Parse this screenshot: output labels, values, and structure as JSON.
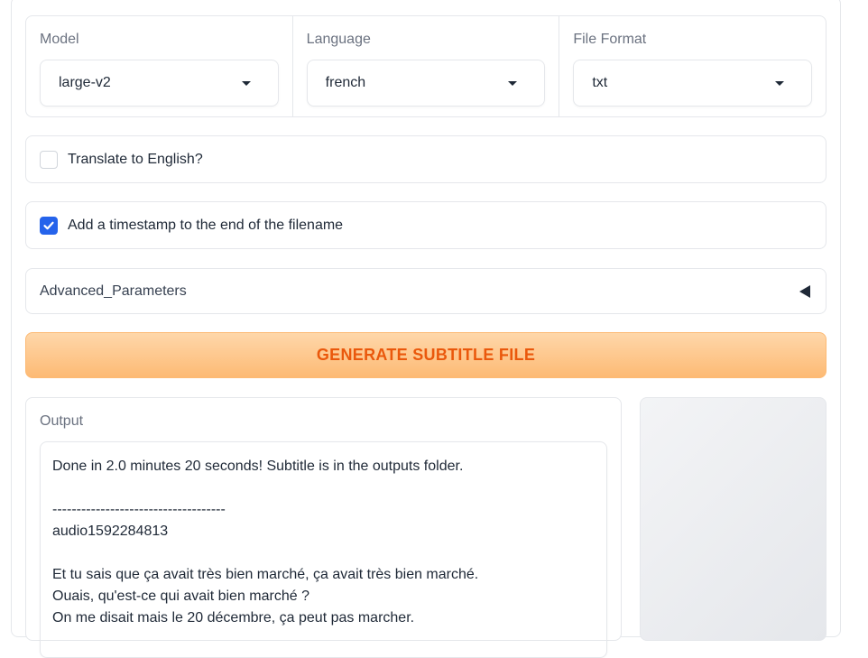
{
  "dropdowns": [
    {
      "label": "Model",
      "value": "large-v2"
    },
    {
      "label": "Language",
      "value": "french"
    },
    {
      "label": "File Format",
      "value": "txt"
    }
  ],
  "translate": {
    "label": "Translate to English?",
    "checked": false
  },
  "timestamp": {
    "label": "Add a timestamp to the end of the filename",
    "checked": true
  },
  "advanced": {
    "label": "Advanced_Parameters"
  },
  "generate_button": {
    "label": "GENERATE SUBTITLE FILE"
  },
  "output": {
    "label": "Output",
    "lines": [
      "Done in 2.0 minutes 20 seconds! Subtitle is in the outputs folder.",
      "",
      "------------------------------------",
      "audio1592284813",
      "",
      "Et tu sais que ça avait très bien marché, ça avait très bien marché.",
      "Ouais, qu'est-ce qui avait bien marché ?",
      "On me disait mais le 20 décembre, ça peut pas marcher."
    ]
  },
  "colors": {
    "accent": "#2563eb",
    "button_text": "#ea580c",
    "button_bg": "#fdba74"
  },
  "icons": {
    "dropdown": "chevron-down-icon",
    "check": "check-icon",
    "accordion": "triangle-left-icon"
  }
}
